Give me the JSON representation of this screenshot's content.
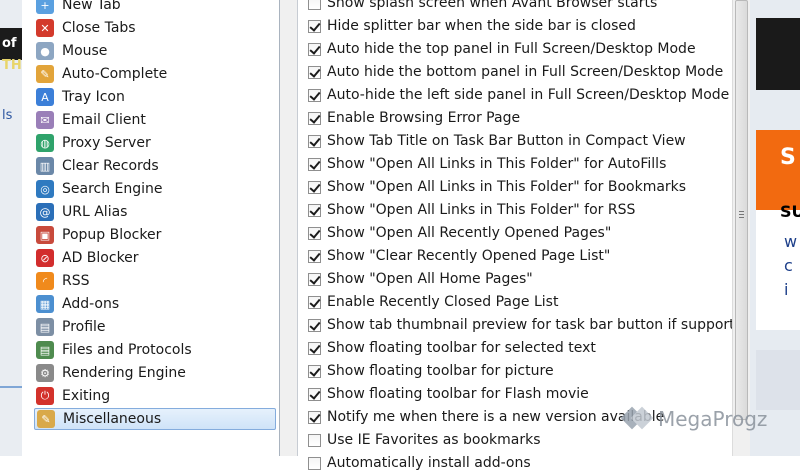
{
  "tree": {
    "items": [
      {
        "label": "New Tab",
        "icon": "new-tab-icon",
        "color": "#5aa0e0",
        "glyph": "+"
      },
      {
        "label": "Close Tabs",
        "icon": "close-tabs-icon",
        "color": "#d33a2c",
        "glyph": "✕"
      },
      {
        "label": "Mouse",
        "icon": "mouse-icon",
        "color": "#8da6c2",
        "glyph": "●"
      },
      {
        "label": "Auto-Complete",
        "icon": "auto-complete-icon",
        "color": "#e2a43a",
        "glyph": "✎"
      },
      {
        "label": "Tray Icon",
        "icon": "tray-icon",
        "color": "#3c7fd8",
        "glyph": "A"
      },
      {
        "label": "Email Client",
        "icon": "email-icon",
        "color": "#9a7fb8",
        "glyph": "✉"
      },
      {
        "label": "Proxy Server",
        "icon": "proxy-server-icon",
        "color": "#2fa36b",
        "glyph": "◍"
      },
      {
        "label": "Clear Records",
        "icon": "trash-icon",
        "color": "#6b88a8",
        "glyph": "▥"
      },
      {
        "label": "Search Engine",
        "icon": "search-engine-icon",
        "color": "#2f7ac0",
        "glyph": "◎"
      },
      {
        "label": "URL Alias",
        "icon": "url-alias-icon",
        "color": "#2b6fb8",
        "glyph": "@"
      },
      {
        "label": "Popup Blocker",
        "icon": "popup-blocker-icon",
        "color": "#c84a3c",
        "glyph": "▣"
      },
      {
        "label": "AD Blocker",
        "icon": "ad-blocker-icon",
        "color": "#d22d2d",
        "glyph": "⊘"
      },
      {
        "label": "RSS",
        "icon": "rss-icon",
        "color": "#f08a1c",
        "glyph": "◜"
      },
      {
        "label": "Add-ons",
        "icon": "add-ons-icon",
        "color": "#4c8fd0",
        "glyph": "▦"
      },
      {
        "label": "Profile",
        "icon": "profile-icon",
        "color": "#7d8fa4",
        "glyph": "▤"
      },
      {
        "label": "Files and Protocols",
        "icon": "files-protocols-icon",
        "color": "#4f8b4f",
        "glyph": "▤"
      },
      {
        "label": "Rendering Engine",
        "icon": "rendering-engine-icon",
        "color": "#8a8a8a",
        "glyph": "⚙"
      },
      {
        "label": "Exiting",
        "icon": "exiting-icon",
        "color": "#d3322b",
        "glyph": "⏻"
      },
      {
        "label": "Miscellaneous",
        "icon": "miscellaneous-icon",
        "color": "#d9a94a",
        "glyph": "✎",
        "selected": true
      }
    ]
  },
  "options": {
    "items": [
      {
        "label": "Show splash screen when Avant Browser starts",
        "checked": false
      },
      {
        "label": "Hide splitter bar when the side bar is closed",
        "checked": true
      },
      {
        "label": "Auto hide the top panel in Full Screen/Desktop Mode",
        "checked": true
      },
      {
        "label": "Auto hide the bottom panel in Full Screen/Desktop Mode",
        "checked": true
      },
      {
        "label": "Auto-hide the left side panel in Full Screen/Desktop Mode",
        "checked": true
      },
      {
        "label": "Enable Browsing Error Page",
        "checked": true
      },
      {
        "label": "Show Tab Title on Task Bar Button in Compact View",
        "checked": true
      },
      {
        "label": "Show \"Open All Links in This Folder\" for AutoFills",
        "checked": true
      },
      {
        "label": "Show \"Open All Links in This Folder\" for Bookmarks",
        "checked": true
      },
      {
        "label": "Show \"Open All Links in This Folder\" for RSS",
        "checked": true
      },
      {
        "label": "Show \"Open All Recently Opened Pages\"",
        "checked": true
      },
      {
        "label": "Show \"Clear Recently Opened Page List\"",
        "checked": true
      },
      {
        "label": "Show \"Open All Home Pages\"",
        "checked": true
      },
      {
        "label": "Enable Recently Closed Page List",
        "checked": true
      },
      {
        "label": "Show tab thumbnail preview for task bar button if supported",
        "checked": true
      },
      {
        "label": "Show floating toolbar for selected text",
        "checked": true
      },
      {
        "label": "Show floating toolbar for picture",
        "checked": true
      },
      {
        "label": "Show floating toolbar for Flash movie",
        "checked": true
      },
      {
        "label": "Notify me when there is a new version available",
        "checked": true
      },
      {
        "label": "Use IE Favorites as bookmarks",
        "checked": false
      },
      {
        "label": "Automatically install add-ons",
        "checked": false
      }
    ]
  },
  "background": {
    "left_fragments": [
      "of",
      "THI",
      "ls"
    ],
    "right_fragments": [
      "S",
      "SU",
      "w",
      "c",
      "i"
    ]
  },
  "watermark": {
    "text": "MegaProgz"
  }
}
